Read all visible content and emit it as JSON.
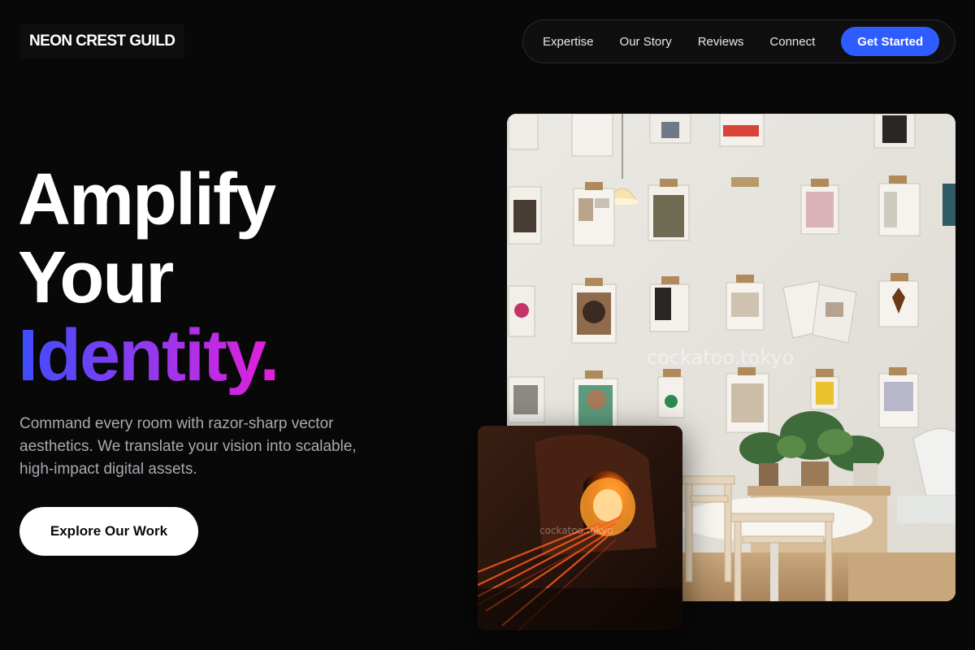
{
  "brand": {
    "name": "NEON CREST GUILD"
  },
  "nav": {
    "links": [
      "Expertise",
      "Our Story",
      "Reviews",
      "Connect"
    ],
    "cta_label": "Get Started"
  },
  "hero": {
    "headline_line1": "Amplify",
    "headline_line2": "Your",
    "headline_line3": "Identity.",
    "description": "Command every room with razor-sharp vector aesthetics. We translate your vision into scalable, high-impact digital assets.",
    "button_label": "Explore Our Work"
  },
  "images": {
    "main_watermark": "cockatoo.tokyo",
    "inset_watermark": "cockatoo.tokyo"
  },
  "colors": {
    "background": "#080808",
    "accent_blue": "#2f5cff",
    "gradient_start": "#3b4dff",
    "gradient_mid": "#8a3cf0",
    "gradient_end": "#e61ed8",
    "muted_text": "#a9a9b2"
  }
}
